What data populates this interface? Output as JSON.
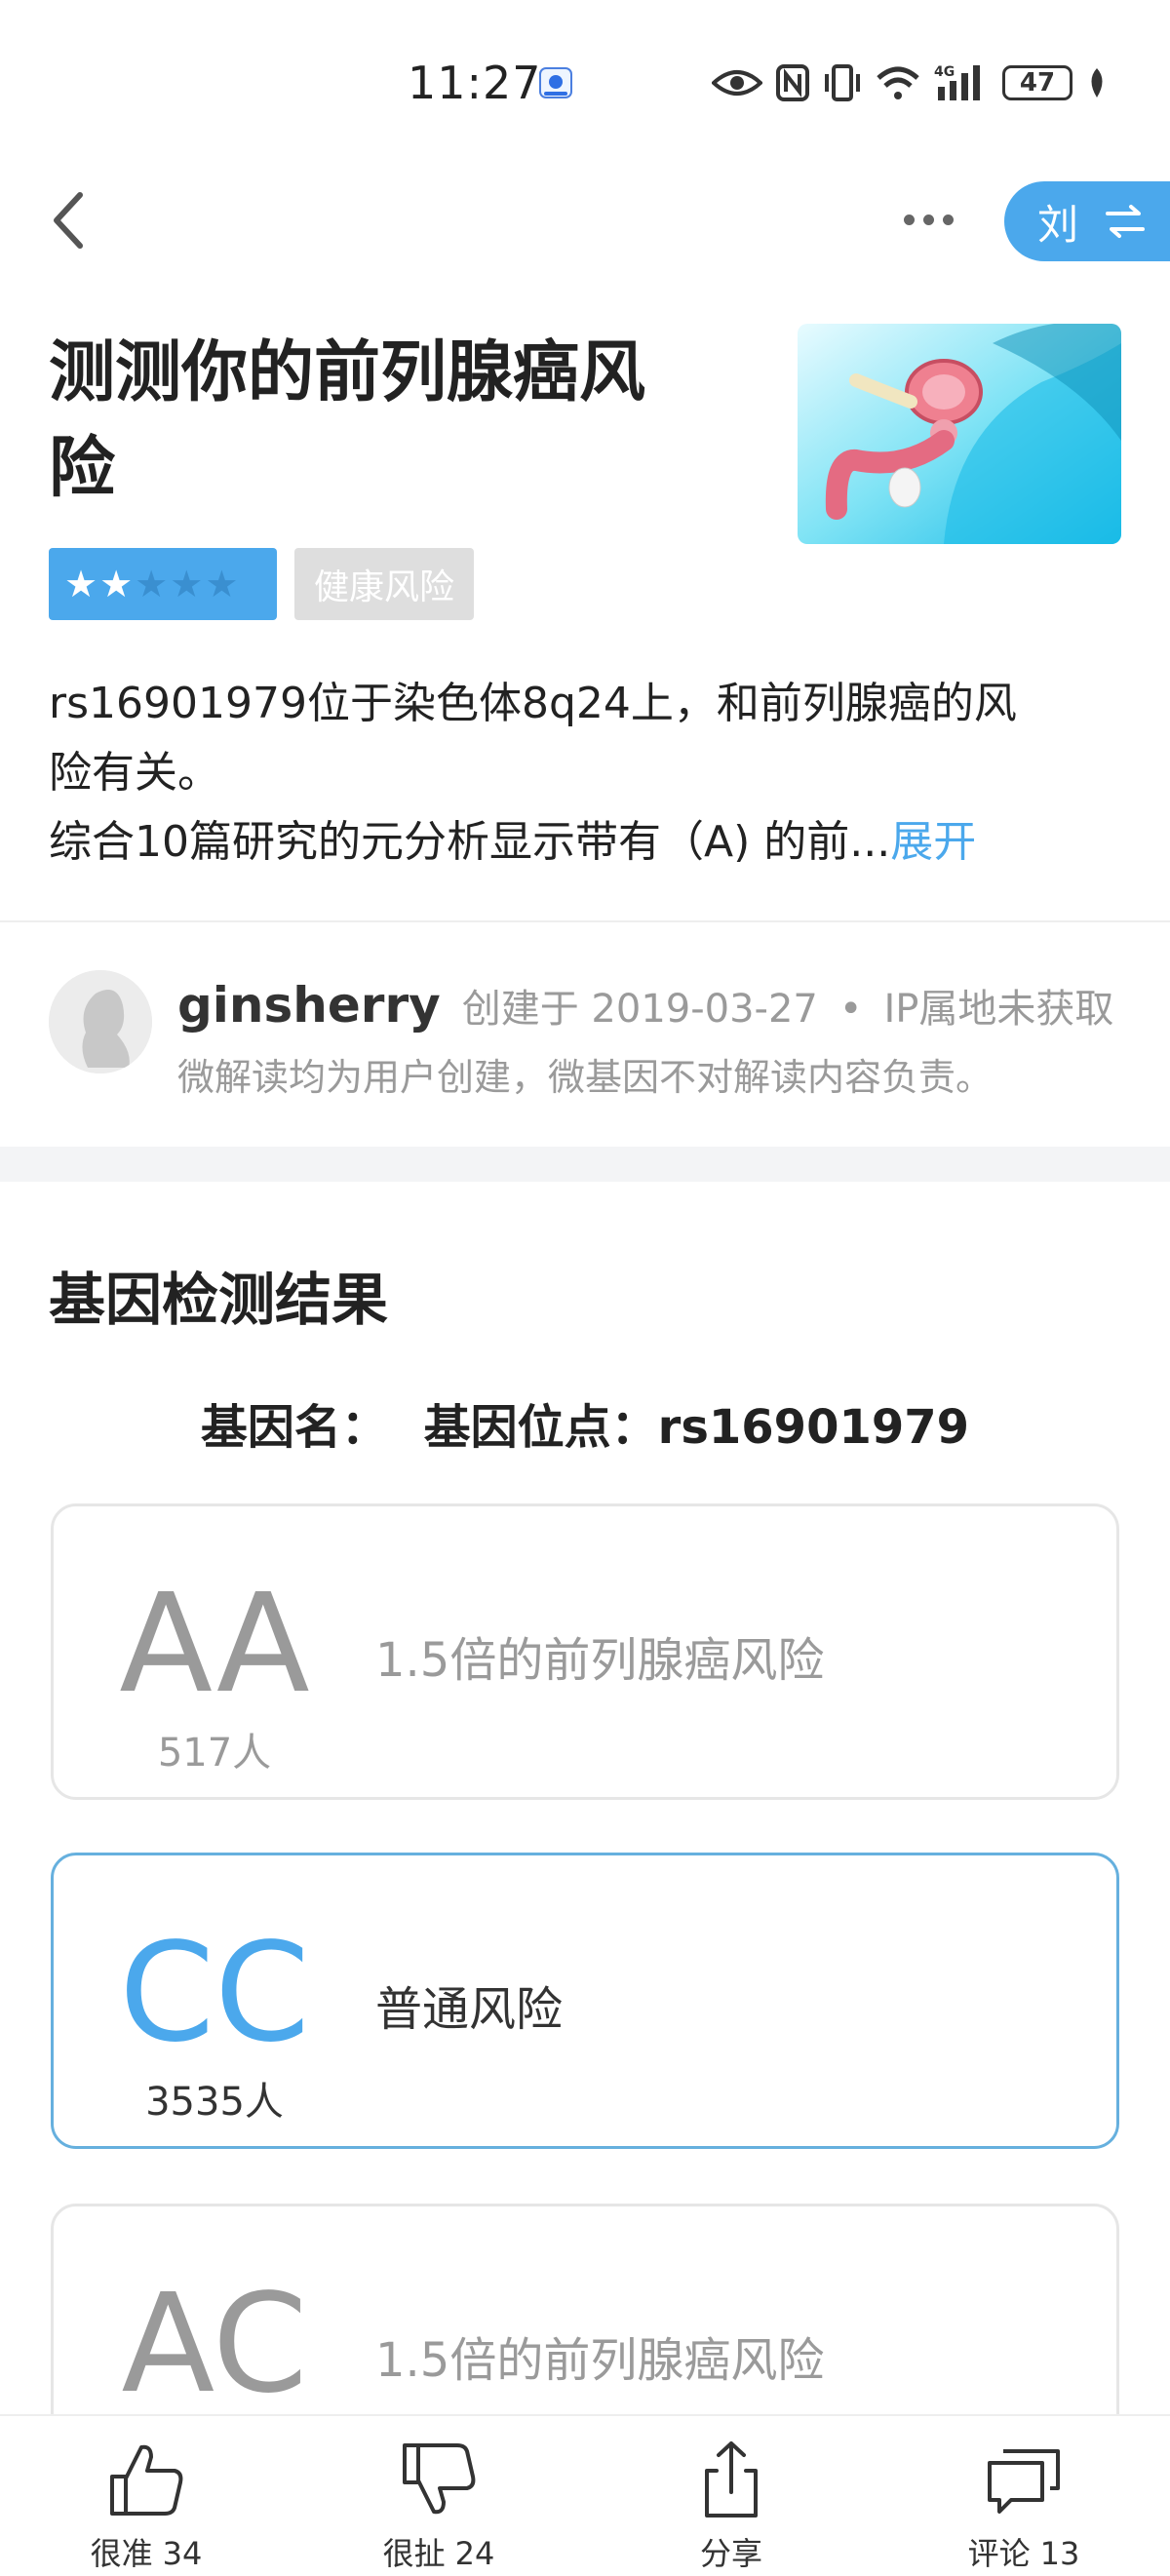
{
  "status_bar": {
    "time": "11:27",
    "battery": "47",
    "network": "4G"
  },
  "nav": {
    "switch_label": "刘"
  },
  "article": {
    "title": "测测你的前列腺癌风险",
    "title_lines": [
      "测测你的前列腺癌风",
      "险"
    ],
    "rating": 2,
    "rating_max": 5,
    "category": "健康风险",
    "desc_line1": "rs16901979位于染色体8q24上，和前列腺癌的风",
    "desc_line2": "险有关。",
    "desc_line3": "综合10篇研究的元分析显示带有（A) 的前...",
    "expand_label": "展开"
  },
  "author": {
    "name": "ginsherry",
    "created": "创建于 2019-03-27",
    "separator": "•",
    "ip": "IP属地未获取",
    "disclaimer": "微解读均为用户创建，微基因不对解读内容负责。"
  },
  "results": {
    "section_title": "基因检测结果",
    "gene_name_label": "基因名：",
    "gene_site_label": "基因位点：rs16901979",
    "cards": [
      {
        "genotype": "AA",
        "count": "517人",
        "risk": "1.5倍的前列腺癌风险",
        "active": false
      },
      {
        "genotype": "CC",
        "count": "3535人",
        "risk": "普通风险",
        "active": true
      },
      {
        "genotype": "AC",
        "count": "",
        "risk": "1.5倍的前列腺癌风险",
        "active": false
      }
    ]
  },
  "bottom_bar": {
    "accurate_label": "很准",
    "accurate_count": "34",
    "nonsense_label": "很扯",
    "nonsense_count": "24",
    "share_label": "分享",
    "comment_label": "评论",
    "comment_count": "13"
  },
  "colors": {
    "accent": "#4ba8ec",
    "muted": "#9a9a9a",
    "tag_bg": "#dedede"
  },
  "icons": [
    "back-icon",
    "more-icon",
    "swap-icon",
    "star-icon",
    "thumbs-up-icon",
    "thumbs-down-icon",
    "share-icon",
    "comment-icon"
  ]
}
